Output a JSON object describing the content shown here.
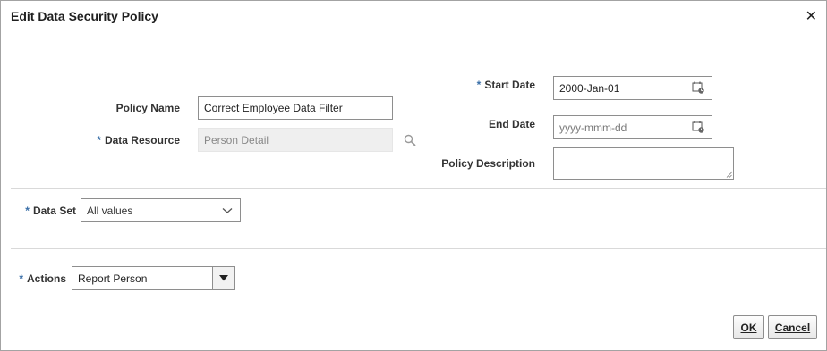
{
  "dialog": {
    "title": "Edit Data Security Policy",
    "close_symbol": "✕"
  },
  "fields": {
    "start_date": {
      "label": "Start Date",
      "value": "2000-Jan-01",
      "required": "*"
    },
    "end_date": {
      "label": "End Date",
      "placeholder": "yyyy-mmm-dd"
    },
    "policy_name": {
      "label": "Policy Name",
      "value": "Correct Employee Data Filter"
    },
    "data_resource": {
      "label": "Data Resource",
      "value": "Person Detail",
      "required": "*"
    },
    "policy_description": {
      "label": "Policy Description",
      "value": ""
    },
    "data_set": {
      "label": "Data Set",
      "value": "All values",
      "required": "*"
    },
    "actions": {
      "label": "Actions",
      "value": "Report Person",
      "required": "*"
    }
  },
  "buttons": {
    "ok": "OK",
    "cancel": "Cancel"
  },
  "icons": {
    "calendar": "calendar-icon",
    "search": "search-icon",
    "dropdown": "chevron-down-icon",
    "close": "close-icon"
  },
  "colors": {
    "required_asterisk": "#3a6fa8",
    "divider": "#d9d9d9",
    "disabled_bg": "#efefef"
  }
}
